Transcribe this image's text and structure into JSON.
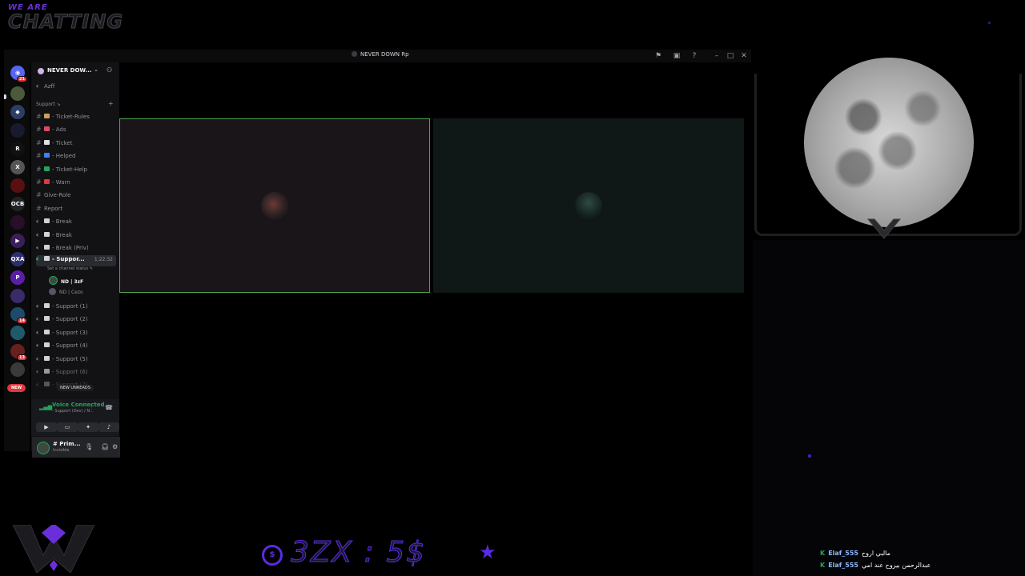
{
  "overlay": {
    "small_text": "WE ARE",
    "big_text": "CHATTING",
    "price_text": "3ZX : 5$",
    "coin_glyph": "$"
  },
  "window": {
    "title": "NEVER DOWN Rp",
    "buttons": [
      "flag-icon",
      "inbox-icon",
      "help-icon",
      "minimize-icon",
      "maximize-icon",
      "close-icon"
    ]
  },
  "server_rail": {
    "badges": [
      "21",
      "14",
      "13"
    ],
    "new_label": "NEW"
  },
  "sidebar": {
    "server_name": "NEVER DOW...",
    "top_channel": "Azff",
    "category": "Support ↘",
    "channels": [
      {
        "label": "- Ticket-Rules",
        "type": "text",
        "color": "#c8a25a"
      },
      {
        "label": "- Ads",
        "type": "text",
        "color": "#e04a6a"
      },
      {
        "label": "- Ticket",
        "type": "text",
        "color": "#e0e0e0"
      },
      {
        "label": "- Helped",
        "type": "text",
        "color": "#3b82f6"
      },
      {
        "label": "- Ticket-Help",
        "type": "text",
        "color": "#23a55a"
      },
      {
        "label": "- Warn",
        "type": "text",
        "color": "#e0383e"
      },
      {
        "label": "Give-Role",
        "type": "text",
        "color": ""
      },
      {
        "label": "Report",
        "type": "text",
        "color": ""
      },
      {
        "label": "- Break",
        "type": "voice",
        "color": "#cfd2d6"
      },
      {
        "label": "- Break",
        "type": "voice",
        "color": "#cfd2d6"
      },
      {
        "label": "- Break (Priv)",
        "type": "voice",
        "color": "#cfd2d6"
      }
    ],
    "active_channel": {
      "label": "- Suppor...",
      "timer": "1:22:32",
      "status": "Set a channel status ✎",
      "users": [
        "ND | 3zF",
        "ND | Cezo"
      ]
    },
    "support_channels": [
      "- Support (1)",
      "- Support (2)",
      "- Support (3)",
      "- Support (4)",
      "- Support (5)",
      "- Support (6)",
      "- Support (7)"
    ],
    "new_unreads": "NEW UNREADS"
  },
  "voice_panel": {
    "status": "Voice Connected",
    "channel": "- Support (Dev) / N..."
  },
  "user_panel": {
    "username": "# Prim...",
    "status": "Invisible"
  },
  "chat": [
    {
      "user": "Elaf_555",
      "message": "مالبي اروح"
    },
    {
      "user": "Elaf_555",
      "message": "عبدالرحمن بيروح عند امي"
    }
  ],
  "colors": {
    "accent_purple": "#5a2be2",
    "speaking_green": "#4fa34f",
    "discord_green": "#23a55a"
  }
}
